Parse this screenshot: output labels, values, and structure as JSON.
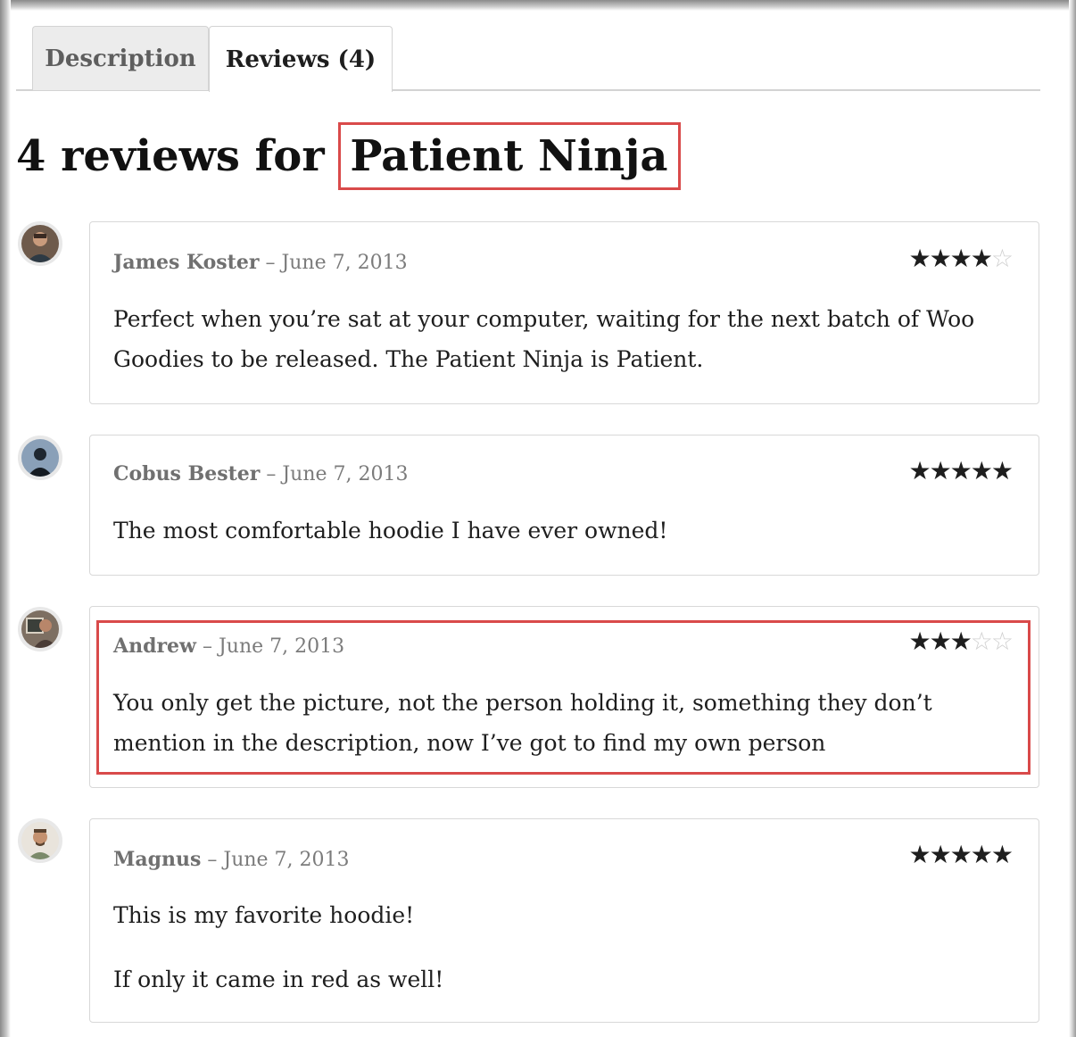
{
  "tabs": [
    {
      "label": "Description",
      "active": false
    },
    {
      "label": "Reviews (4)",
      "active": true
    }
  ],
  "heading": {
    "prefix": "4 reviews for ",
    "product": "Patient Ninja"
  },
  "colors": {
    "highlight": "#d94a4a",
    "star": "#1e1e1e",
    "star_empty": "#cfcfcf"
  },
  "reviews": [
    {
      "author": "James Koster",
      "separator": "–",
      "date": "June 7, 2013",
      "rating": 4,
      "max_rating": 5,
      "paragraphs": [
        "Perfect when you’re sat at your computer, waiting for the next batch of Woo Goodies to be released. The Patient Ninja is Patient."
      ]
    },
    {
      "author": "Cobus Bester",
      "separator": "–",
      "date": "June 7, 2013",
      "rating": 5,
      "max_rating": 5,
      "paragraphs": [
        "The most comfortable hoodie I have ever owned!"
      ]
    },
    {
      "author": "Andrew",
      "separator": "–",
      "date": "June 7, 2013",
      "rating": 3,
      "max_rating": 5,
      "paragraphs": [
        "You only get the picture, not the person holding it, something they don’t mention in the description, now I’ve got to find my own person"
      ]
    },
    {
      "author": "Magnus",
      "separator": "–",
      "date": "June 7, 2013",
      "rating": 5,
      "max_rating": 5,
      "paragraphs": [
        "This is my favorite hoodie!",
        "If only it came in red as well!"
      ]
    }
  ]
}
